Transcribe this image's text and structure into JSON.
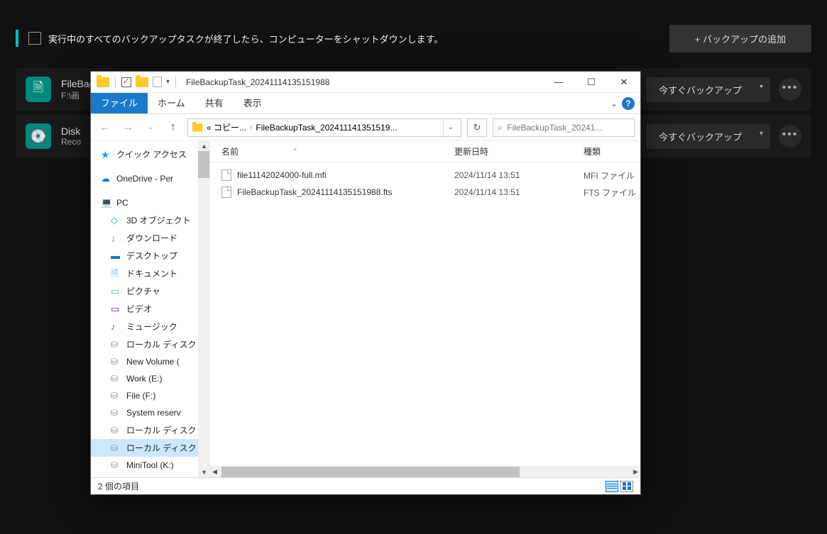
{
  "bg": {
    "shutdown_label": "実行中のすべてのバックアップタスクが終了したら、コンピューターをシャットダウンします。",
    "add_backup_label": "+ バックアップの追加",
    "backup_now_label": "今すぐバックアップ",
    "tasks": [
      {
        "name": "FileBackupTask",
        "path": "F:\\画"
      },
      {
        "name": "Disk",
        "path": "Reco"
      }
    ]
  },
  "explorer": {
    "title": "FileBackupTask_20241114135151988",
    "ribbon": {
      "file": "ファイル",
      "home": "ホーム",
      "share": "共有",
      "view": "表示"
    },
    "addr": {
      "prefix": "«  コピー...",
      "current": "FileBackupTask_202411141351519..."
    },
    "search_placeholder": "FileBackupTask_20241...",
    "columns": {
      "name": "名前",
      "date": "更新日時",
      "type": "種類"
    },
    "sidebar": {
      "quick_access": "クイック アクセス",
      "onedrive": "OneDrive - Per",
      "pc": "PC",
      "items": [
        "3D オブジェクト",
        "ダウンロード",
        "デスクトップ",
        "ドキュメント",
        "ピクチャ",
        "ビデオ",
        "ミュージック",
        "ローカル ディスク",
        "New Volume (",
        "Work (E:)",
        "File (F:)",
        "System reserv",
        "ローカル ディスク",
        "ローカル ディスク",
        "MiniTool (K:)"
      ]
    },
    "files": [
      {
        "name": "file11142024000-full.mfi",
        "date": "2024/11/14 13:51",
        "type": "MFI ファイル"
      },
      {
        "name": "FileBackupTask_20241114135151988.fts",
        "date": "2024/11/14 13:51",
        "type": "FTS ファイル"
      }
    ],
    "status": "2 個の項目"
  }
}
